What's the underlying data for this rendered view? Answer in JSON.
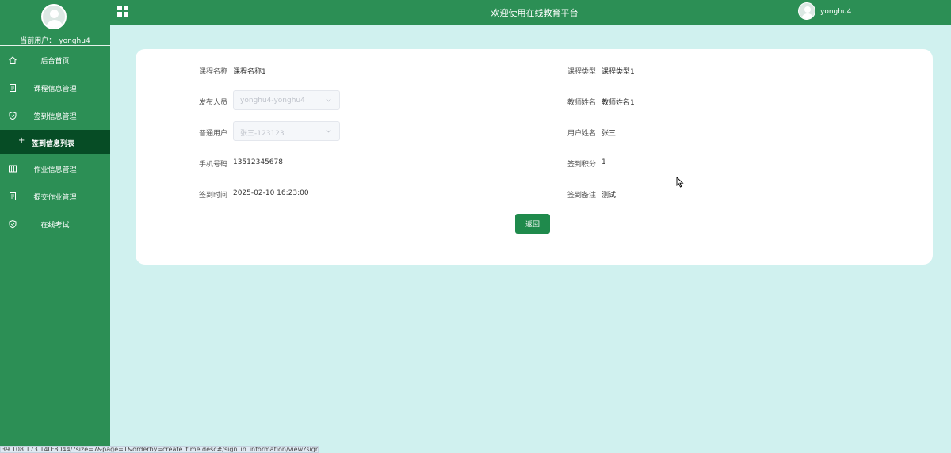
{
  "sidebar": {
    "current_user_label": "当前用户：",
    "current_user_name": "yonghu4",
    "items": [
      {
        "label": "后台首页",
        "icon": "home-icon"
      },
      {
        "label": "课程信息管理",
        "icon": "document-icon"
      },
      {
        "label": "签到信息管理",
        "icon": "shield-icon"
      },
      {
        "label": "作业信息管理",
        "icon": "columns-icon"
      },
      {
        "label": "提交作业管理",
        "icon": "document-icon"
      },
      {
        "label": "在线考试",
        "icon": "shield-icon"
      }
    ],
    "active_sub": {
      "label": "签到信息列表",
      "prefix": "+"
    }
  },
  "header": {
    "title": "欢迎使用在线教育平台",
    "username": "yonghu4",
    "menu_icon": "grid-icon"
  },
  "form": {
    "course_name": {
      "label": "课程名称",
      "value": "课程名称1"
    },
    "course_type": {
      "label": "课程类型",
      "value": "课程类型1"
    },
    "publisher": {
      "label": "发布人员",
      "value": "yonghu4-yonghu4"
    },
    "teacher_name": {
      "label": "教师姓名",
      "value": "教师姓名1"
    },
    "regular_user": {
      "label": "普通用户",
      "value": "张三-123123"
    },
    "user_name": {
      "label": "用户姓名",
      "value": "张三"
    },
    "phone": {
      "label": "手机号码",
      "value": "13512345678"
    },
    "points": {
      "label": "签到积分",
      "value": "1"
    },
    "sign_time": {
      "label": "签到时间",
      "value": "2025-02-10 16:23:00"
    },
    "note": {
      "label": "签到备注",
      "value": "测试"
    },
    "back_button": "返回"
  },
  "status_bar": {
    "url": "39.108.173.140:8044/?size=7&page=1&orderby=create_time desc#/sign_in_information/view?sign_in_infor..."
  },
  "colors": {
    "primary": "#2c8f55",
    "active_sub": "#064c25",
    "background": "#d0f1ef",
    "button": "#1f8a4c"
  }
}
